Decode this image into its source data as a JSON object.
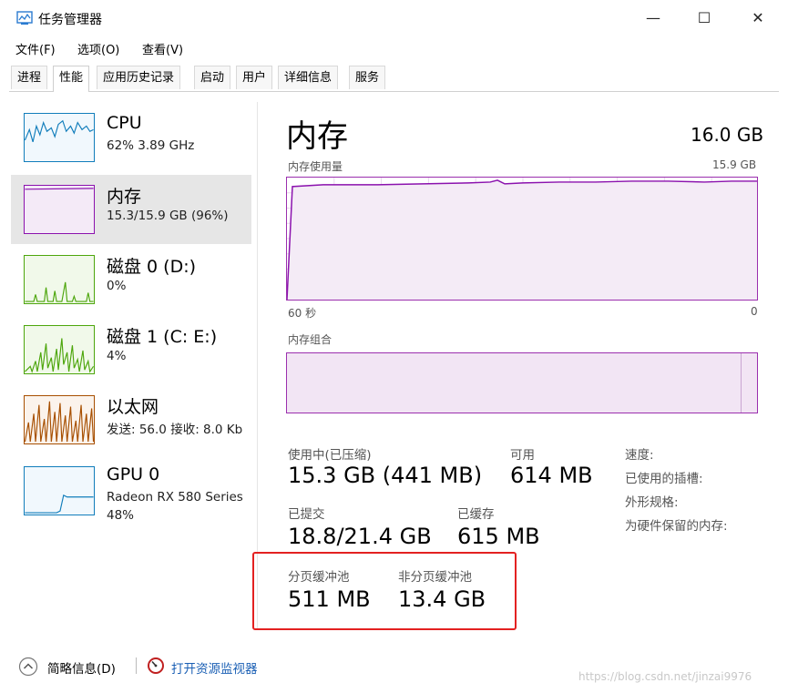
{
  "window": {
    "title": "任务管理器",
    "minimize": "—",
    "maximize": "☐",
    "close": "✕"
  },
  "menu": [
    "文件(F)",
    "选项(O)",
    "查看(V)"
  ],
  "tabs": [
    "进程",
    "性能",
    "应用历史记录",
    "启动",
    "用户",
    "详细信息",
    "服务"
  ],
  "active_tab": "性能",
  "resources": [
    {
      "name": "CPU",
      "detail": "62% 3.89 GHz",
      "color": "#117dbb"
    },
    {
      "name": "内存",
      "detail": "15.3/15.9 GB (96%)",
      "color": "#8b12ae"
    },
    {
      "name": "磁盘 0 (D:)",
      "detail": "0%",
      "color": "#4da60c"
    },
    {
      "name": "磁盘 1 (C: E:)",
      "detail": "4%",
      "color": "#4da60c"
    },
    {
      "name": "以太网",
      "detail": "发送: 56.0 接收: 8.0 Kb",
      "color": "#a74f01"
    },
    {
      "name": "GPU 0",
      "detail": "Radeon RX 580 Series",
      "detail2": "48%",
      "color": "#117dbb"
    }
  ],
  "memory": {
    "title": "内存",
    "total": "16.0 GB",
    "usage_label": "内存使用量",
    "usage_max": "15.9 GB",
    "axis_left": "60 秒",
    "axis_right": "0",
    "composition_label": "内存组合",
    "in_use_label": "使用中(已压缩)",
    "in_use_value": "15.3 GB (441 MB)",
    "available_label": "可用",
    "available_value": "614 MB",
    "committed_label": "已提交",
    "committed_value": "18.8/21.4 GB",
    "cached_label": "已缓存",
    "cached_value": "615 MB",
    "paged_label": "分页缓冲池",
    "paged_value": "511 MB",
    "nonpaged_label": "非分页缓冲池",
    "nonpaged_value": "13.4 GB",
    "speed_label": "速度:",
    "slots_label": "已使用的插槽:",
    "form_label": "外形规格:",
    "reserved_label": "为硬件保留的内存:"
  },
  "footer": {
    "summary": "简略信息(D)",
    "monitor": "打开资源监视器"
  },
  "watermark": "https://blog.csdn.net/jinzai9976"
}
